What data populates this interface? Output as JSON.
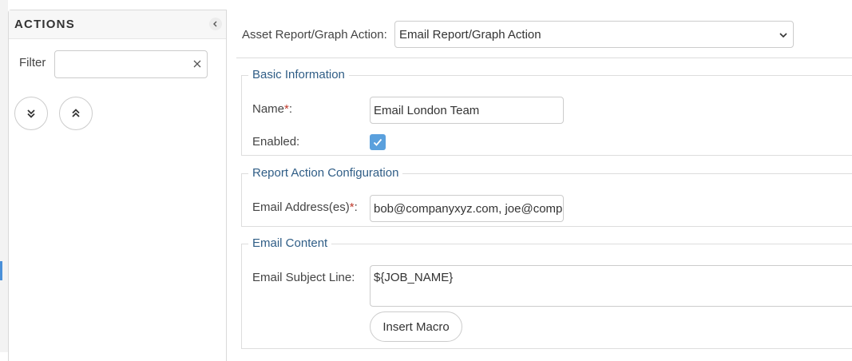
{
  "sidebar": {
    "title": "ACTIONS",
    "filter_label": "Filter",
    "filter_value": "",
    "filter_placeholder": "",
    "expand_all_icon": "chevrons-down-icon",
    "collapse_all_icon": "chevrons-up-icon"
  },
  "main": {
    "action_type_label": "Asset Report/Graph Action:",
    "action_type_value": "Email Report/Graph Action",
    "basic": {
      "legend": "Basic Information",
      "name_label": "Name",
      "name_required": "*",
      "name_colon": ":",
      "name_value": "Email London Team",
      "enabled_label": "Enabled:",
      "enabled_checked": true
    },
    "report": {
      "legend": "Report Action Configuration",
      "email_label": "Email Address(es)",
      "email_required": "*",
      "email_colon": ":",
      "email_value": "bob@companyxyz.com, joe@companyxyz.com"
    },
    "email_content": {
      "legend": "Email Content",
      "subject_label": "Email Subject Line:",
      "subject_value": "${JOB_NAME}",
      "insert_macro_label": "Insert Macro"
    }
  },
  "colors": {
    "accent": "#5aa0dd",
    "legend_text": "#2f5d86",
    "required": "#c0392b"
  }
}
